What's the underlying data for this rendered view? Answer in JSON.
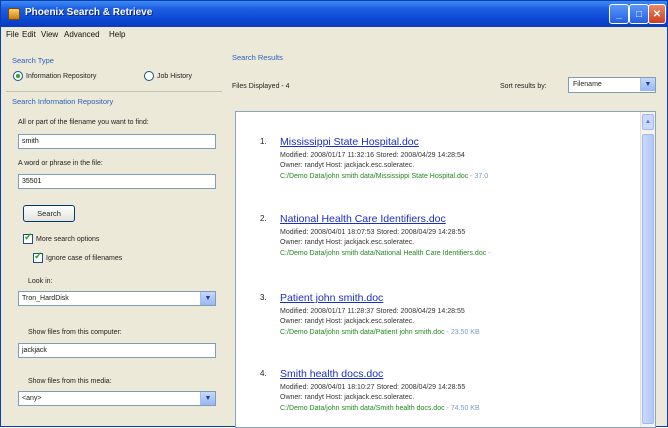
{
  "window": {
    "title": "Phoenix Search & Retrieve"
  },
  "menu": [
    "File",
    "Edit",
    "View",
    "Advanced",
    "Help"
  ],
  "search_type": {
    "header": "Search Type",
    "options": [
      "Information Repository",
      "Job History"
    ],
    "selected": "Information Repository"
  },
  "search_repo": {
    "header": "Search Information Repository",
    "filename_label": "All or part of the filename you want to find:",
    "filename_value": "smith",
    "phrase_label": "A word or phrase in the file:",
    "phrase_value": "35501",
    "search_button": "Search",
    "more_options_label": "More search options",
    "more_options_checked": true,
    "ignore_case_label": "Ignore case of filenames",
    "ignore_case_checked": true,
    "look_in_label": "Look in:",
    "look_in_value": "Tron_HardDisk",
    "computer_label": "Show files from this computer:",
    "computer_value": "jackjack",
    "media_label": "Show files from this media:",
    "media_value": "<any>"
  },
  "results": {
    "header": "Search Results",
    "files_displayed": "Files Displayed - 4",
    "sort_label": "Sort results by:",
    "sort_value": "Filename",
    "items": [
      {
        "num": "1.",
        "title": "Mississippi State Hospital.doc",
        "meta": "Modified: 2008/01/17 11:32:16    Stored: 2008/04/29 14:28:54",
        "owner": "Owner: randyt    Host: jackjack.esc.solerateс.",
        "path": "C:/Demo Data/john smith data/Mississippi State Hospital.doc",
        "size": "- 37.0"
      },
      {
        "num": "2.",
        "title": "National Health Care Identifiers.doc",
        "meta": "Modified: 2008/04/01 18:07:53    Stored: 2008/04/29 14:28:55",
        "owner": "Owner: randyt    Host: jackjack.esc.solerateс.",
        "path": "C:/Demo Data/john smith data/National Health Care Identifiers.doc",
        "size": "-"
      },
      {
        "num": "3.",
        "title": "Patient john smith.doc",
        "meta": "Modified: 2008/01/17 11:28:37    Stored: 2008/04/29 14:28:55",
        "owner": "Owner: randyt    Host: jackjack.esc.solerateс.",
        "path": "C:/Demo Data/john smith data/Patient john smith.doc",
        "size": "- 23.50 KB"
      },
      {
        "num": "4.",
        "title": "Smith health docs.doc",
        "meta": "Modified: 2008/04/01 18:10:27    Stored: 2008/04/29 14:28:55",
        "owner": "Owner: randyt    Host: jackjack.esc.solerateс.",
        "path": "C:/Demo Data/john smith data/Smith health docs.doc",
        "size": "- 74.50 KB"
      }
    ]
  }
}
